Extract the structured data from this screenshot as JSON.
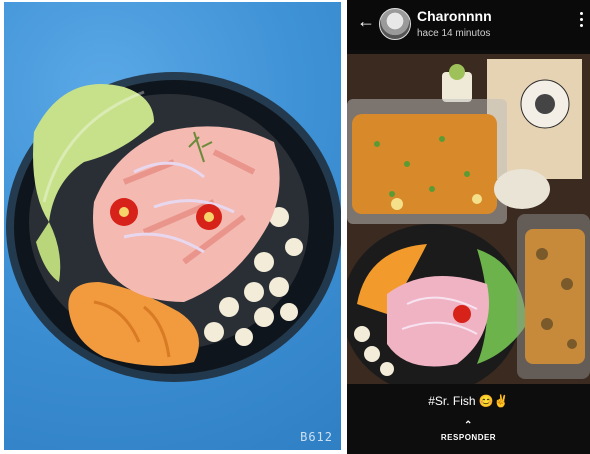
{
  "left_photo": {
    "watermark": "B612",
    "description_icon": "ceviche-bowl-photo"
  },
  "story": {
    "username": "Charonnnn",
    "timestamp": "hace 14 minutos",
    "caption": "#Sr. Fish 😊✌",
    "reply_label": "RESPONDER",
    "photo_icon": "food-containers-photo"
  },
  "colors": {
    "background_blue": "#3f92d6",
    "story_background": "#0d0d0d",
    "text": "#ffffff"
  }
}
